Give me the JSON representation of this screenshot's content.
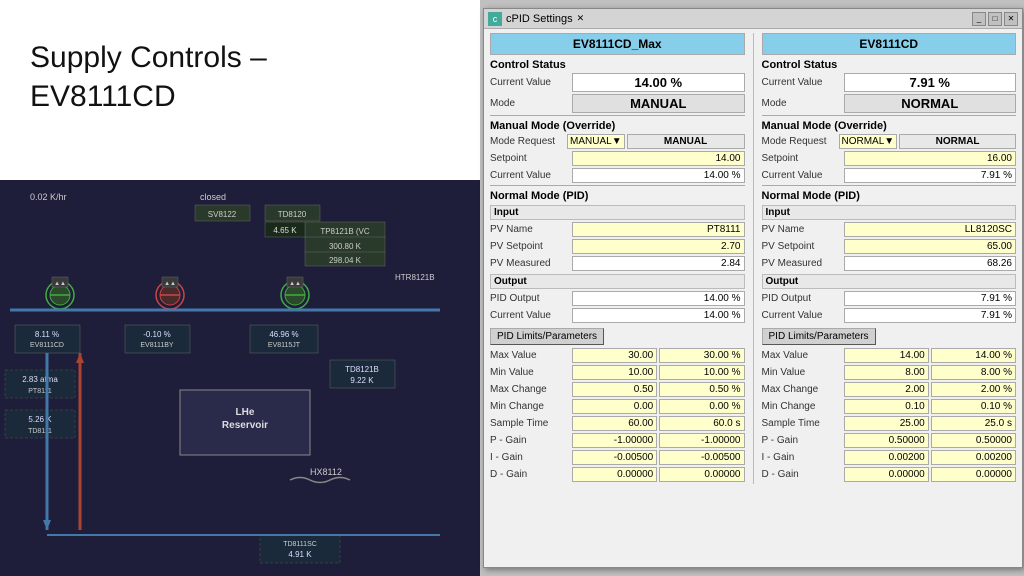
{
  "left": {
    "title_line1": "Supply Controls –",
    "title_line2": "EV8111CD"
  },
  "window": {
    "title": "cPID Settings",
    "tab": "cPID Settings",
    "col1_header": "EV8111CD_Max",
    "col2_header": "EV8111CD",
    "col1": {
      "control_status": "Control Status",
      "current_value_label": "Current Value",
      "current_value": "14.00 %",
      "mode_label": "Mode",
      "mode_value": "MANUAL",
      "manual_mode_title": "Manual Mode (Override)",
      "mode_request_label": "Mode Request",
      "mode_request_dropdown": "MANUAL",
      "mode_request_display": "MANUAL",
      "setpoint_label": "Setpoint",
      "setpoint_value": "14.00",
      "current_value2_label": "Current Value",
      "current_value2": "14.00 %",
      "normal_mode_title": "Normal Mode (PID)",
      "input_sub": "Input",
      "pv_name_label": "PV Name",
      "pv_name": "PT8111",
      "pv_setpoint_label": "PV Setpoint",
      "pv_setpoint": "2.70",
      "pv_measured_label": "PV Measured",
      "pv_measured": "2.84",
      "output_sub": "Output",
      "pid_output_label": "PID Output",
      "pid_output": "14.00 %",
      "output_current_label": "Current Value",
      "output_current": "14.00 %",
      "pid_limits_btn": "PID Limits/Parameters",
      "max_value_label": "Max Value",
      "max_value1": "30.00",
      "max_value2": "30.00 %",
      "min_value_label": "Min Value",
      "min_value1": "10.00",
      "min_value2": "10.00 %",
      "max_change_label": "Max Change",
      "max_change1": "0.50",
      "max_change2": "0.50 %",
      "min_change_label": "Min Change",
      "min_change1": "0.00",
      "min_change2": "0.00 %",
      "sample_time_label": "Sample Time",
      "sample_time1": "60.00",
      "sample_time2": "60.0 s",
      "p_gain_label": "P - Gain",
      "p_gain1": "-1.00000",
      "p_gain2": "-1.00000",
      "i_gain_label": "I - Gain",
      "i_gain1": "-0.00500",
      "i_gain2": "-0.00500",
      "d_gain_label": "D - Gain",
      "d_gain1": "0.00000",
      "d_gain2": "0.00000"
    },
    "col2": {
      "control_status": "Control Status",
      "current_value_label": "Current Value",
      "current_value": "7.91 %",
      "mode_label": "Mode",
      "mode_value": "NORMAL",
      "manual_mode_title": "Manual Mode (Override)",
      "mode_request_label": "Mode Request",
      "mode_request_dropdown": "NORMAL",
      "mode_request_display": "NORMAL",
      "setpoint_label": "Setpoint",
      "setpoint_value": "16.00",
      "current_value2_label": "Current Value",
      "current_value2": "7.91 %",
      "normal_mode_title": "Normal Mode (PID)",
      "input_sub": "Input",
      "pv_name_label": "PV Name",
      "pv_name": "LL8120SC",
      "pv_setpoint_label": "PV Setpoint",
      "pv_setpoint": "65.00",
      "pv_measured_label": "PV Measured",
      "pv_measured": "68.26",
      "output_sub": "Output",
      "pid_output_label": "PID Output",
      "pid_output": "7.91 %",
      "output_current_label": "Current Value",
      "output_current": "7.91 %",
      "pid_limits_btn": "PID Limits/Parameters",
      "max_value_label": "Max Value",
      "max_value1": "14.00",
      "max_value2": "14.00 %",
      "min_value_label": "Min Value",
      "min_value1": "8.00",
      "min_value2": "8.00 %",
      "max_change_label": "Max Change",
      "max_change1": "2.00",
      "max_change2": "2.00 %",
      "min_change_label": "Min Change",
      "min_change1": "0.10",
      "min_change2": "0.10 %",
      "sample_time_label": "Sample Time",
      "sample_time1": "25.00",
      "sample_time2": "25.0 s",
      "p_gain_label": "P - Gain",
      "p_gain1": "0.50000",
      "p_gain2": "0.50000",
      "i_gain_label": "I - Gain",
      "i_gain1": "0.00200",
      "i_gain2": "0.00200",
      "d_gain_label": "D - Gain",
      "d_gain1": "0.00000",
      "d_gain2": "0.00000"
    }
  },
  "diagram": {
    "labels": {
      "sv8122": "SV8122",
      "td8120": "TD8120",
      "tp8121b_vc": "TP8121B (VC",
      "val1": "300.80 K",
      "val2": "298.04 K",
      "val3": "4.65 K",
      "htr8121b": "HTR8121B",
      "ev8111cd": "EV8111CD",
      "pct1": "8.11 %",
      "ev8111by": "EV8111BY",
      "pct2": "-0.10 %",
      "ev8115jt": "EV8115JT",
      "pct3": "46.96 %",
      "td8121b": "TD8121B",
      "val4": "9.22 K",
      "pt8111": "PT8111",
      "val5": "2.83 atma",
      "td8111": "TD8111",
      "val6": "5.26 K",
      "lhe_reservoir": "LHe\nReservoir",
      "hx8112": "HX8112",
      "td8111sc": "TD8111SC",
      "val7": "4.91 K",
      "val_top": "0.02 K/hr",
      "val_top2": "closed"
    }
  }
}
